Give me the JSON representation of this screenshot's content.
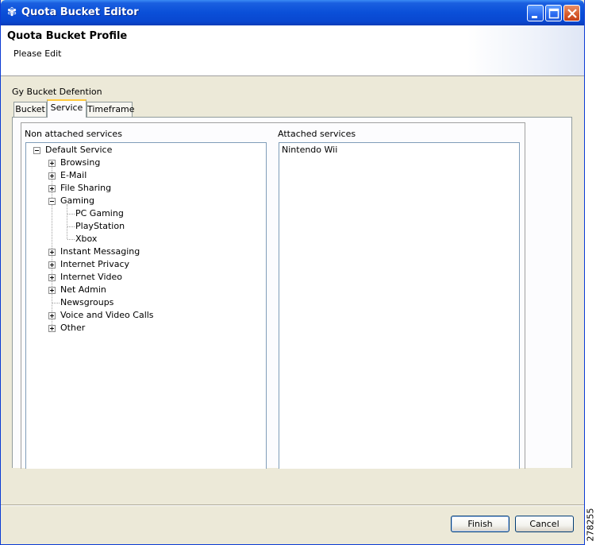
{
  "window": {
    "title": "Quota Bucket Editor",
    "icon": "gear-snowflake-icon"
  },
  "header": {
    "title": "Quota Bucket Profile",
    "subtitle": "Please Edit"
  },
  "group": {
    "label": "Gy Bucket Defention"
  },
  "tabs": [
    {
      "label": "Bucket",
      "active": false
    },
    {
      "label": "Service",
      "active": true
    },
    {
      "label": "Timeframe",
      "active": false
    }
  ],
  "non_attached": {
    "label": "Non attached services",
    "root": "Default Service",
    "items": [
      {
        "label": "Browsing",
        "expander": "plus"
      },
      {
        "label": "E-Mail",
        "expander": "plus"
      },
      {
        "label": "File Sharing",
        "expander": "plus"
      },
      {
        "label": "Gaming",
        "expander": "minus"
      },
      {
        "label": "PC Gaming",
        "child": true
      },
      {
        "label": "PlayStation",
        "child": true
      },
      {
        "label": "Xbox",
        "child": true
      },
      {
        "label": "Instant Messaging",
        "expander": "plus"
      },
      {
        "label": "Internet Privacy",
        "expander": "plus"
      },
      {
        "label": "Internet Video",
        "expander": "plus"
      },
      {
        "label": "Net Admin",
        "expander": "plus"
      },
      {
        "label": "Newsgroups",
        "expander": "none"
      },
      {
        "label": "Voice and Video Calls",
        "expander": "plus"
      },
      {
        "label": "Other",
        "expander": "plus"
      }
    ]
  },
  "attached": {
    "label": "Attached services",
    "items": [
      "Nintendo Wii"
    ]
  },
  "buttons": {
    "finish": "Finish",
    "cancel": "Cancel"
  },
  "side_code": "278255",
  "colors": {
    "titlebar": "#0a4fd8",
    "window_bg": "#ece9d8",
    "tab_highlight": "#ffc83c"
  }
}
